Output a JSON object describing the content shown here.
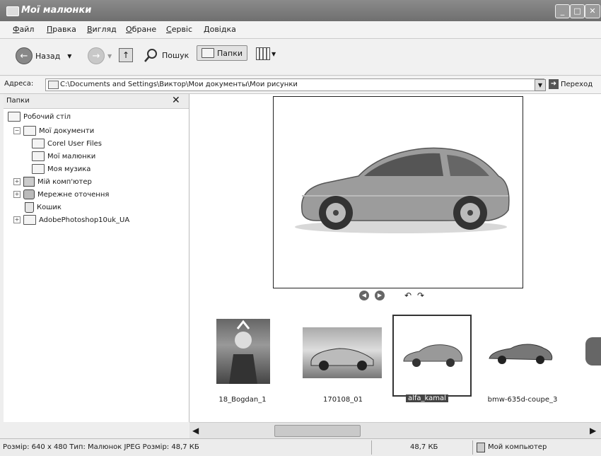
{
  "window": {
    "title": "Мої малюнки"
  },
  "menu": [
    "Файл",
    "Правка",
    "Вигляд",
    "Обране",
    "Сервіс",
    "Довідка"
  ],
  "toolbar": {
    "back_label": "Назад",
    "search_label": "Пошук",
    "folders_label": "Папки"
  },
  "address": {
    "label": "Адреса:",
    "value": "C:\\Documents and Settings\\Виктор\\Мои документы\\Мои рисунки",
    "go_label": "Переход"
  },
  "sidebar": {
    "title": "Папки",
    "tree": [
      {
        "label": "Робочий стіл",
        "level": 0,
        "expander": ""
      },
      {
        "label": "Мої документи",
        "level": 1,
        "expander": "−"
      },
      {
        "label": "Corel User Files",
        "level": 2,
        "expander": ""
      },
      {
        "label": "Мої малюнки",
        "level": 2,
        "expander": ""
      },
      {
        "label": "Моя музика",
        "level": 2,
        "expander": ""
      },
      {
        "label": "Мій комп'ютер",
        "level": 1,
        "expander": "+"
      },
      {
        "label": "Мережне оточення",
        "level": 1,
        "expander": "+"
      },
      {
        "label": "Кошик",
        "level": 1,
        "expander": ""
      },
      {
        "label": "AdobePhotoshop10uk_UA",
        "level": 1,
        "expander": "+"
      }
    ]
  },
  "thumbnails": [
    {
      "name": "18_Bogdan_1",
      "selected": false
    },
    {
      "name": "170108_01",
      "selected": false
    },
    {
      "name": "alfa_kamal",
      "selected": true
    },
    {
      "name": "bmw-635d-coupe_3",
      "selected": false
    }
  ],
  "status": {
    "info": "Розмір: 640 x 480 Тип: Малюнок JPEG Розмір: 48,7 КБ",
    "size": "48,7 КБ",
    "zone": "Мой компьютер"
  }
}
